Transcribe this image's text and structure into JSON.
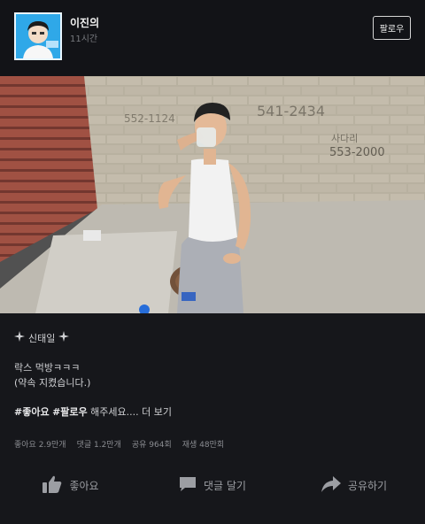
{
  "header": {
    "author_name": "이진의",
    "post_time": "11시간",
    "follow_label": "팔로우"
  },
  "post": {
    "title": "신태일",
    "line1": "락스 먹방ㅋㅋㅋ",
    "line2": "(약속 지켰습니다.)",
    "tag1": "#좋아요",
    "tag2": "#팔로우",
    "tag_rest": " 해주세요.... ",
    "more_label": "더 보기"
  },
  "stats": {
    "likes": "좋아요 2.9만개",
    "comments": "댓글 1.2만개",
    "shares": "공유 964회",
    "views": "재생 48만회"
  },
  "actions": {
    "like_label": "좋아요",
    "comment_label": "댓글 달기",
    "share_label": "공유하기"
  },
  "colors": {
    "background": "#16171b",
    "header_bg": "#121317",
    "avatar_bg": "#2fa8e8"
  }
}
